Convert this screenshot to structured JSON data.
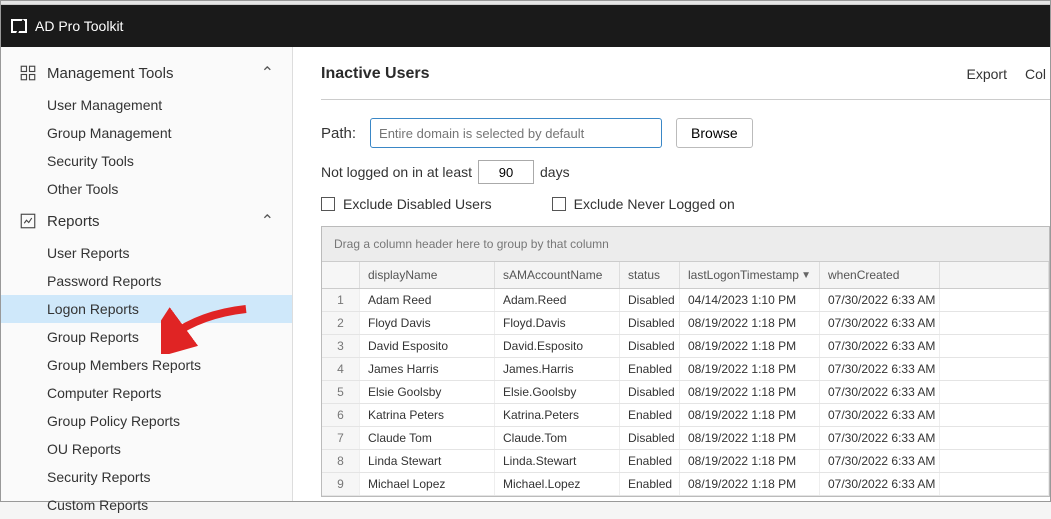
{
  "app": {
    "title": "AD Pro Toolkit"
  },
  "sidebar": {
    "groups": [
      {
        "label": "Management Tools",
        "icon": "management-icon",
        "items": [
          {
            "label": "User Management"
          },
          {
            "label": "Group Management"
          },
          {
            "label": "Security Tools"
          },
          {
            "label": "Other Tools"
          }
        ]
      },
      {
        "label": "Reports",
        "icon": "reports-icon",
        "items": [
          {
            "label": "User Reports"
          },
          {
            "label": "Password Reports"
          },
          {
            "label": "Logon Reports",
            "active": true
          },
          {
            "label": "Group Reports"
          },
          {
            "label": "Group Members Reports"
          },
          {
            "label": "Computer Reports"
          },
          {
            "label": "Group Policy Reports"
          },
          {
            "label": "OU Reports"
          },
          {
            "label": "Security Reports"
          },
          {
            "label": "Custom Reports"
          }
        ]
      }
    ]
  },
  "page": {
    "title": "Inactive Users",
    "actions": {
      "export": "Export",
      "columns": "Col"
    }
  },
  "filters": {
    "path_label": "Path:",
    "path_placeholder": "Entire domain is selected by default",
    "browse": "Browse",
    "days_prefix": "Not logged on in at least",
    "days_value": "90",
    "days_suffix": "days",
    "exclude_disabled": "Exclude Disabled Users",
    "exclude_never": "Exclude Never Logged on"
  },
  "grid": {
    "group_hint": "Drag a column header here to group by that column",
    "columns": {
      "displayName": "displayName",
      "sAMAccountName": "sAMAccountName",
      "status": "status",
      "lastLogonTimestamp": "lastLogonTimestamp",
      "whenCreated": "whenCreated"
    },
    "rows": [
      {
        "n": "1",
        "displayName": "Adam Reed",
        "sam": "Adam.Reed",
        "status": "Disabled",
        "logon": "04/14/2023 1:10 PM",
        "created": "07/30/2022 6:33 AM"
      },
      {
        "n": "2",
        "displayName": "Floyd Davis",
        "sam": "Floyd.Davis",
        "status": "Disabled",
        "logon": "08/19/2022 1:18 PM",
        "created": "07/30/2022 6:33 AM"
      },
      {
        "n": "3",
        "displayName": "David Esposito",
        "sam": "David.Esposito",
        "status": "Disabled",
        "logon": "08/19/2022 1:18 PM",
        "created": "07/30/2022 6:33 AM"
      },
      {
        "n": "4",
        "displayName": "James Harris",
        "sam": "James.Harris",
        "status": "Enabled",
        "logon": "08/19/2022 1:18 PM",
        "created": "07/30/2022 6:33 AM"
      },
      {
        "n": "5",
        "displayName": "Elsie Goolsby",
        "sam": "Elsie.Goolsby",
        "status": "Disabled",
        "logon": "08/19/2022 1:18 PM",
        "created": "07/30/2022 6:33 AM"
      },
      {
        "n": "6",
        "displayName": "Katrina Peters",
        "sam": "Katrina.Peters",
        "status": "Enabled",
        "logon": "08/19/2022 1:18 PM",
        "created": "07/30/2022 6:33 AM"
      },
      {
        "n": "7",
        "displayName": "Claude Tom",
        "sam": "Claude.Tom",
        "status": "Disabled",
        "logon": "08/19/2022 1:18 PM",
        "created": "07/30/2022 6:33 AM"
      },
      {
        "n": "8",
        "displayName": "Linda Stewart",
        "sam": "Linda.Stewart",
        "status": "Enabled",
        "logon": "08/19/2022 1:18 PM",
        "created": "07/30/2022 6:33 AM"
      },
      {
        "n": "9",
        "displayName": "Michael Lopez",
        "sam": "Michael.Lopez",
        "status": "Enabled",
        "logon": "08/19/2022 1:18 PM",
        "created": "07/30/2022 6:33 AM"
      }
    ]
  }
}
